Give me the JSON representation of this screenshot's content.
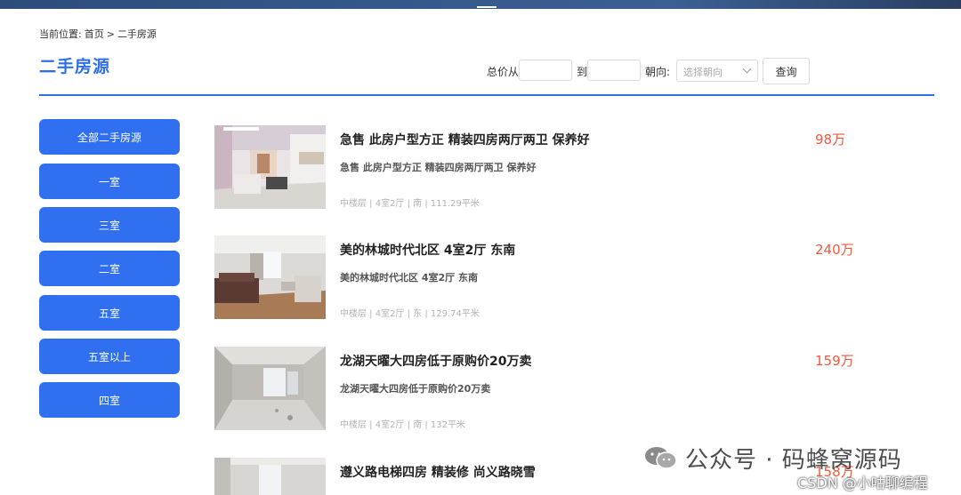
{
  "breadcrumb": {
    "prefix": "当前位置:",
    "home": "首页",
    "separator": ">",
    "current": "二手房源"
  },
  "page_title": "二手房源",
  "filters": {
    "price_from_label": "总价从",
    "price_to_label": "到",
    "price_from_value": "",
    "price_to_value": "",
    "orientation_label": "朝向:",
    "orientation_placeholder": "选择朝向",
    "query_label": "查询"
  },
  "sidebar": {
    "items": [
      {
        "label": "全部二手房源"
      },
      {
        "label": "一室"
      },
      {
        "label": "三室"
      },
      {
        "label": "二室"
      },
      {
        "label": "五室"
      },
      {
        "label": "五室以上"
      },
      {
        "label": "四室"
      }
    ]
  },
  "listings": [
    {
      "title": "急售 此房户型方正 精装四房两厅两卫 保养好",
      "subtitle": "急售 此房户型方正 精装四房两厅两卫 保养好",
      "meta": "中楼层 | 4室2厅 | 南 | 111.29平米",
      "price": "98万"
    },
    {
      "title": "美的林城时代北区 4室2厅 东南",
      "subtitle": "美的林城时代北区 4室2厅 东南",
      "meta": "中楼层 | 4室2厅 | 东 | 129.74平米",
      "price": "240万"
    },
    {
      "title": "龙湖天曜大四房低于原购价20万卖",
      "subtitle": "龙湖天曜大四房低于原购价20万卖",
      "meta": "中楼层 | 4室2厅 | 南 | 132平米",
      "price": "159万"
    },
    {
      "title": "遵义路电梯四房 精装修 尚义路晓雪",
      "subtitle": "",
      "meta": "",
      "price": "158万"
    }
  ],
  "watermark": {
    "text": "公众号 · 码蜂窝源码",
    "sub": "CSDN @小咕聊编程"
  },
  "colors": {
    "accent": "#2f70e8",
    "sidebar_button": "#2f6ff0",
    "price": "#f0593e",
    "topbar": "#2c4d7a"
  }
}
